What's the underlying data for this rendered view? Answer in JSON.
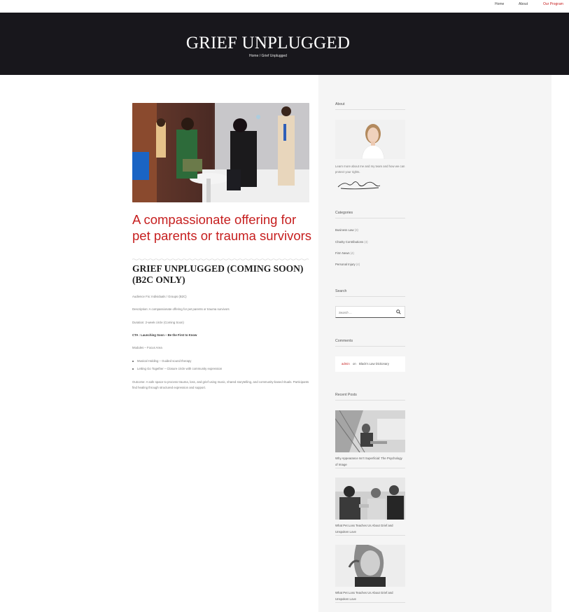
{
  "nav": {
    "home": "Home",
    "about": "About",
    "program": "Our Program"
  },
  "hero": {
    "title": "GRIEF UNPLUGGED",
    "breadcrumb": "Home / Grief Unplugged"
  },
  "post": {
    "headline": "A compassionate offering for pet parents or trauma survivors",
    "subtitle": "GRIEF UNPLUGGED (COMING SOON) (B2C ONLY)",
    "audience": "Audience Fix: Individuals / Groups (B2C)",
    "description": "Description: A compassionate offering for pet parents or trauma survivors",
    "duration": "Duration: 2-week circle (Coming Soon)",
    "cta": "CTA : Launching Soon – Be the First to Know",
    "modules_label": "Modules – Focus Area",
    "modules": [
      "Musical Holding – Guided sound therapy",
      "Letting Go Together – Closure circle with community expression"
    ],
    "outcome": "Outcome: A safe space to process trauma, loss, and grief using music, shared storytelling, and community-based rituals. Participants find healing through structured expression and support."
  },
  "sidebar": {
    "about": {
      "title": "About",
      "text": "Learn more about me and my team and how we can protect your rights."
    },
    "categories": {
      "title": "Categories",
      "items": [
        {
          "label": "Business Law",
          "count": "(3)"
        },
        {
          "label": "Charity Contributions",
          "count": "(4)"
        },
        {
          "label": "Firm News",
          "count": "(4)"
        },
        {
          "label": "Personal Injury",
          "count": "(4)"
        }
      ]
    },
    "search": {
      "title": "Search",
      "placeholder": "Search …"
    },
    "comments": {
      "title": "Comments",
      "author": "admin",
      "on": "on",
      "post": "Black's Law Dictionary"
    },
    "recent": {
      "title": "Recent Posts",
      "items": [
        "Why Appearance Isn't Superficial: The Psychology of Image",
        "What Pet Loss Teaches Us About Grief and Unspoken Love",
        "What Pet Loss Teaches Us About Grief and Unspoken Love"
      ]
    }
  },
  "colors": {
    "accent": "#c61e1e",
    "hero_bg": "#18171c",
    "sidebar_bg": "#f5f5f5"
  }
}
